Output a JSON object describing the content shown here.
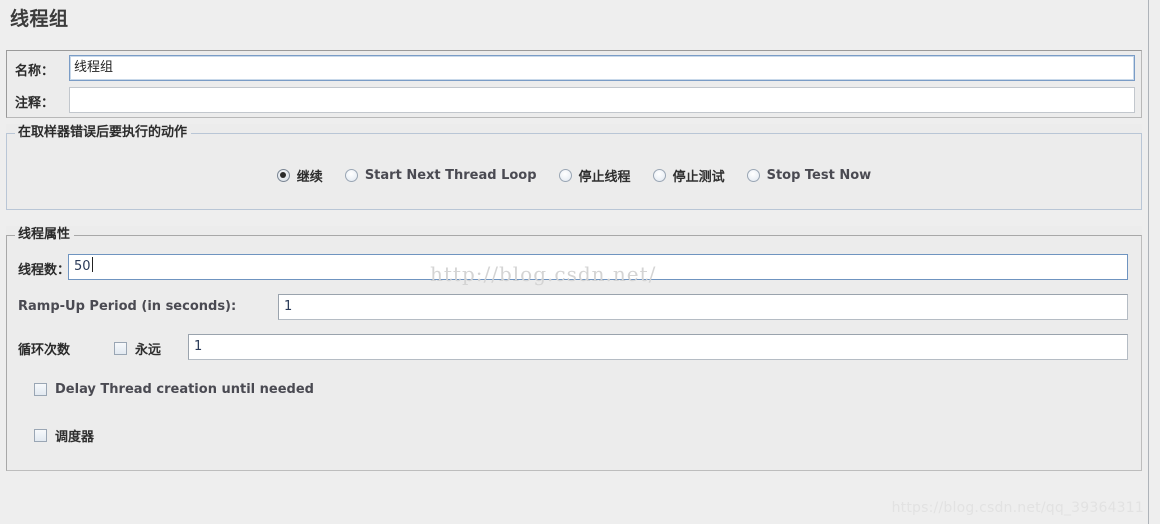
{
  "page": {
    "title": "线程组",
    "background_color": "#eeeeee"
  },
  "identity": {
    "name_label": "名称：",
    "name_value": "线程组",
    "name_placeholder": "",
    "comment_label": "注释：",
    "comment_value": "",
    "comment_placeholder": ""
  },
  "error_action": {
    "group_title": "在取样器错误后要执行的动作",
    "options": [
      {
        "label": "继续",
        "selected": true,
        "script": "cjk"
      },
      {
        "label": "Start Next Thread Loop",
        "selected": false,
        "script": "latin"
      },
      {
        "label": "停止线程",
        "selected": false,
        "script": "cjk"
      },
      {
        "label": "停止测试",
        "selected": false,
        "script": "cjk"
      },
      {
        "label": "Stop Test Now",
        "selected": false,
        "script": "latin"
      }
    ]
  },
  "thread_properties": {
    "group_title": "线程属性",
    "threads_label": "线程数：",
    "threads_value": "50",
    "threads_focused": true,
    "ramp_label": "Ramp-Up Period (in seconds):",
    "ramp_value": "1",
    "loop_label": "循环次数",
    "loop_forever_label": "永远",
    "loop_forever_checked": false,
    "loop_value": "1",
    "delay_label": "Delay Thread creation until needed",
    "delay_checked": false,
    "scheduler_label": "调度器",
    "scheduler_checked": false
  },
  "watermarks": {
    "center": "http://blog.csdn.net/",
    "corner": "https://blog.csdn.net/qq_39364311"
  },
  "colors": {
    "panel": "#ececec",
    "background": "#eeeeee",
    "group_border_blue": "#b9c6d6",
    "group_border_gray": "#a8a8a8",
    "field_border": "#b5bcc4",
    "focus_border": "#6f94c0",
    "text": "#2b2b2b",
    "latin_text": "#4a4a52"
  }
}
